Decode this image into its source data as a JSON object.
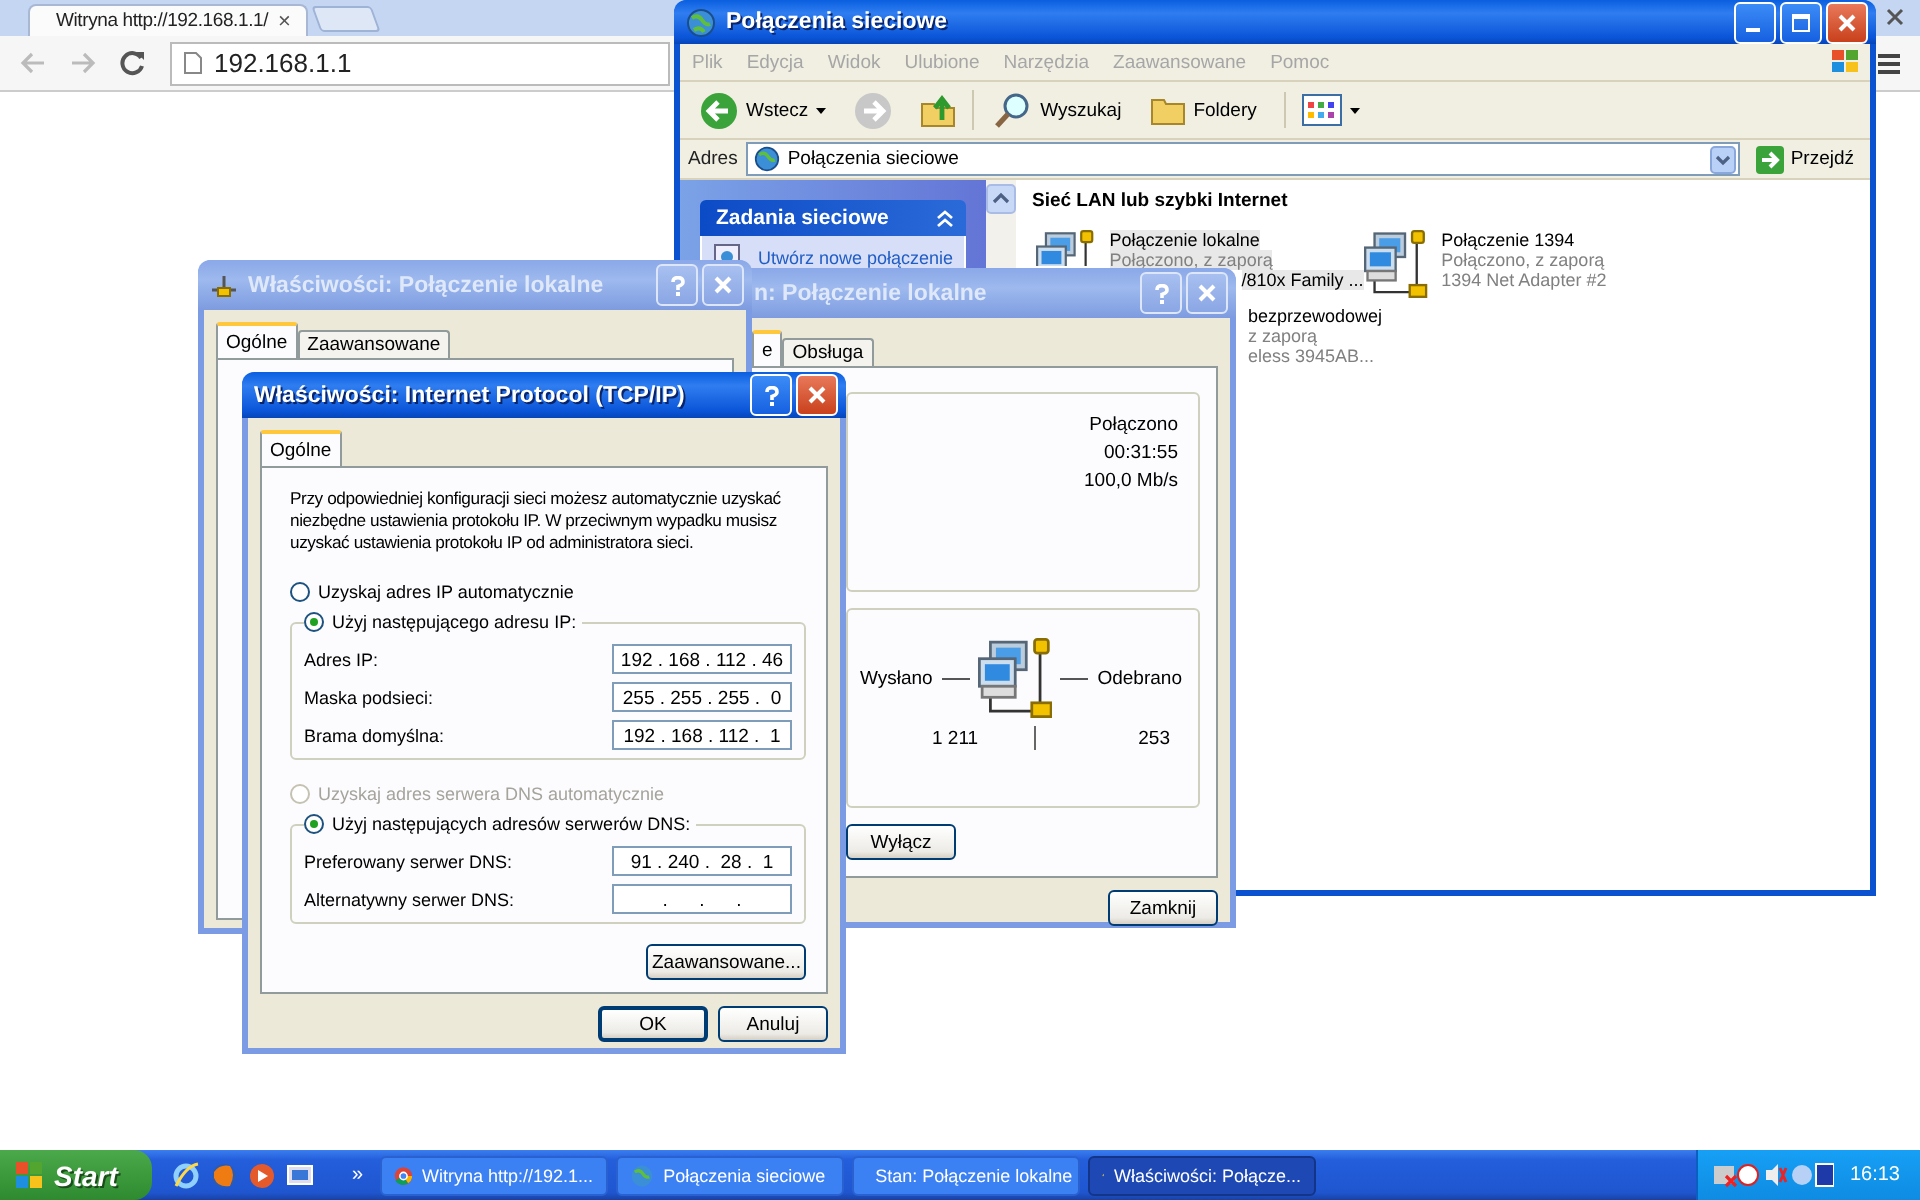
{
  "browser": {
    "tabs": [
      {
        "title": "Witryna http://192.168.1.1/",
        "close": "×",
        "selected": true
      }
    ],
    "address": "192.168.1.1"
  },
  "explorer": {
    "title": "Połączenia sieciowe",
    "active": true,
    "menu": [
      "Plik",
      "Edycja",
      "Widok",
      "Ulubione",
      "Narzędzia",
      "Zaawansowane",
      "Pomoc"
    ],
    "toolbar": [
      {
        "kind": "back",
        "label": "Wstecz"
      },
      {
        "kind": "forward"
      },
      {
        "kind": "up"
      },
      {
        "kind": "search",
        "label": "Wyszukaj"
      },
      {
        "kind": "folders",
        "label": "Foldery"
      },
      {
        "kind": "views"
      }
    ],
    "address_label": "Adres",
    "address": "Połączenia sieciowe",
    "go": "Przejdź",
    "task_panel": {
      "title": "Zadania sieciowe",
      "expanded": true,
      "items": [
        "Utwórz nowe połączenie"
      ]
    },
    "group_title": "Sieć LAN lub szybki Internet",
    "connections": [
      {
        "name": "Połączenie lokalne",
        "lines": [
          "Połączono, z zaporą",
          "/810x Family ..."
        ],
        "selected": true
      },
      {
        "name": "Połączenie 1394",
        "lines": [
          "Połączono, z zaporą",
          "1394 Net Adapter #2"
        ],
        "selected": false
      },
      {
        "name": "bezprzewodowej",
        "lines": [
          "z zaporą",
          "eless 3945AB..."
        ],
        "selected": false
      }
    ]
  },
  "properties": {
    "title": "Właściwości: Połączenie lokalne",
    "active": false,
    "tabs": [
      {
        "label": "Ogólne",
        "selected": true
      },
      {
        "label": "Zaawansowane",
        "selected": false
      }
    ]
  },
  "status": {
    "title": "n: Połączenie lokalne",
    "active": false,
    "tabs": [
      {
        "label": "e",
        "selected": true
      },
      {
        "label": "Obsługa",
        "selected": false
      }
    ],
    "state": "Połączono",
    "duration": "00:31:55",
    "speed": "100,0 Mb/s",
    "sent_label": "Wysłano",
    "received_label": "Odebrano",
    "sent": "1 211",
    "received": "253",
    "disable_button": "Wyłącz",
    "close_button": "Zamknij"
  },
  "tcpip": {
    "title": "Właściwości: Internet Protocol (TCP/IP)",
    "active": true,
    "tabs": [
      {
        "label": "Ogólne",
        "selected": true
      }
    ],
    "intro": "Przy odpowiedniej konfiguracji sieci możesz automatycznie uzyskać niezbędne ustawienia protokołu IP. W przeciwnym wypadku musisz uzyskać ustawienia protokołu IP od administratora sieci.",
    "ip_options": [
      {
        "label": "Uzyskaj adres IP automatycznie",
        "selected": false,
        "disabled": false
      },
      {
        "label": "Użyj następującego adresu IP:",
        "selected": true,
        "disabled": false
      }
    ],
    "ip_fields": [
      {
        "label": "Adres IP:",
        "value": "192 . 168 . 112 . 46"
      },
      {
        "label": "Maska podsieci:",
        "value": "255 . 255 . 255 .  0"
      },
      {
        "label": "Brama domyślna:",
        "value": "192 . 168 . 112 .  1"
      }
    ],
    "dns_options": [
      {
        "label": "Uzyskaj adres serwera DNS automatycznie",
        "selected": false,
        "disabled": true
      },
      {
        "label": "Użyj następujących adresów serwerów DNS:",
        "selected": true,
        "disabled": false
      }
    ],
    "dns_fields": [
      {
        "label": "Preferowany serwer DNS:",
        "value": "91 . 240 .  28 .  1"
      },
      {
        "label": "Alternatywny serwer DNS:",
        "value": ".      .      ."
      }
    ],
    "advanced_button": "Zaawansowane...",
    "ok_button": "OK",
    "cancel_button": "Anuluj"
  },
  "taskbar": {
    "start": "Start",
    "more": "»",
    "tasks": [
      {
        "kind": "browser",
        "label": "Witryna http://192.1...",
        "selected": false
      },
      {
        "kind": "network",
        "label": "Połączenia sieciowe",
        "selected": false
      },
      {
        "kind": "connection",
        "label": "Stan: Połączenie lokalne",
        "selected": false
      },
      {
        "kind": "connection",
        "label": "Właściwości: Połącze...",
        "selected": true
      }
    ],
    "clock": "16:13"
  }
}
